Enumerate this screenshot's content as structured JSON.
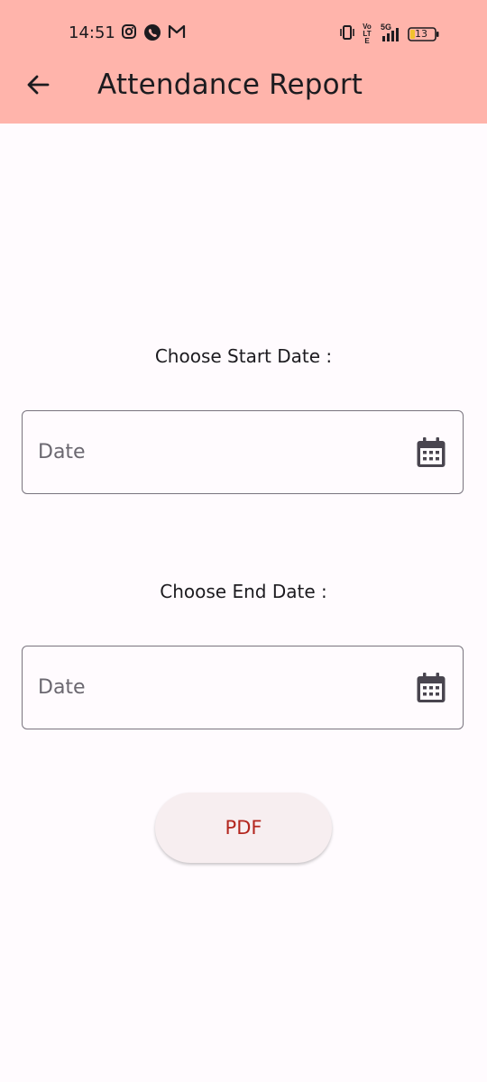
{
  "status_bar": {
    "time": "14:51",
    "left_icons": [
      "instagram-icon",
      "whatsapp-icon",
      "gmail-icon"
    ],
    "right_icons": [
      "vibrate-icon",
      "volte-icon",
      "signal-5g-icon"
    ],
    "network_label": "5G",
    "volte_label": "Vo LTE",
    "battery": "13"
  },
  "app_bar": {
    "title": "Attendance Report",
    "background": "#FFB4AB"
  },
  "start_date": {
    "label": "Choose Start Date :",
    "placeholder": "Date"
  },
  "end_date": {
    "label": "Choose End Date :",
    "placeholder": "Date"
  },
  "pdf_button": {
    "label": "PDF",
    "color": "#B3261E"
  }
}
